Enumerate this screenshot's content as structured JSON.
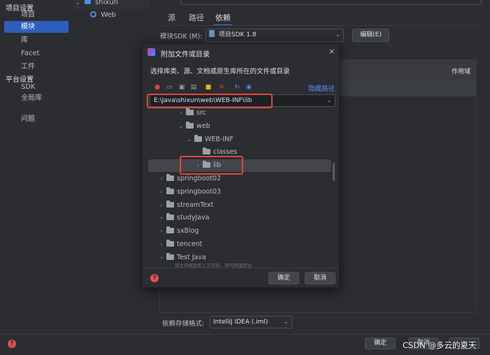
{
  "left_panel": {
    "section_project": "项目设置",
    "items_project": [
      "项目",
      "模块",
      "库",
      "Facet",
      "工件"
    ],
    "section_platform": "平台设置",
    "items_platform": [
      "SDK",
      "全局库"
    ],
    "problems": "问题"
  },
  "module_tree": {
    "root": "shixun",
    "child": "Web"
  },
  "tabs": [
    "源",
    "路径",
    "依赖"
  ],
  "sdk_row": {
    "label": "模块SDK (M):",
    "value": "项目SDK 1.8",
    "edit_button": "编辑(E)"
  },
  "deps_table": {
    "scope_header": "作用域"
  },
  "storage_format": {
    "label": "依赖存储格式:",
    "value": "IntelliJ IDEA (.iml)"
  },
  "bottom_buttons": {
    "ok": "确定",
    "cancel": "取消"
  },
  "watermark": "CSDN @多云的夏天",
  "dialog": {
    "title": "附加文件或目录",
    "description": "选择库类、源、文档或原生库所在的文件或目录",
    "hide_path_link": "隐藏路径",
    "path_value": "E:\\Java\\shixun\\web\\WEB-INF\\lib",
    "hint": "将文件拖放到上方空间，即可快速定位",
    "ok": "确定",
    "cancel": "取消",
    "tree": [
      {
        "label": "src",
        "chevron": "›",
        "depth": 1
      },
      {
        "label": "web",
        "chevron": "⌄",
        "depth": 1
      },
      {
        "label": "WEB-INF",
        "chevron": "⌄",
        "depth": 2
      },
      {
        "label": "classes",
        "chevron": "",
        "depth": 3
      },
      {
        "label": "lib",
        "chevron": "›",
        "depth": 3,
        "selected": true
      },
      {
        "label": "springboot02",
        "chevron": "›",
        "depth": 0
      },
      {
        "label": "springboot03",
        "chevron": "›",
        "depth": 0
      },
      {
        "label": "streamText",
        "chevron": "›",
        "depth": 0
      },
      {
        "label": "studyJava",
        "chevron": "›",
        "depth": 0
      },
      {
        "label": "sxBlog",
        "chevron": "›",
        "depth": 0
      },
      {
        "label": "tencent",
        "chevron": "›",
        "depth": 0
      },
      {
        "label": "Test Java",
        "chevron": "›",
        "depth": 0
      }
    ]
  },
  "colors": {
    "accent": "#3574f0",
    "selection": "#2e5ebd",
    "highlight_box": "#e0473c",
    "link": "#548af7"
  }
}
